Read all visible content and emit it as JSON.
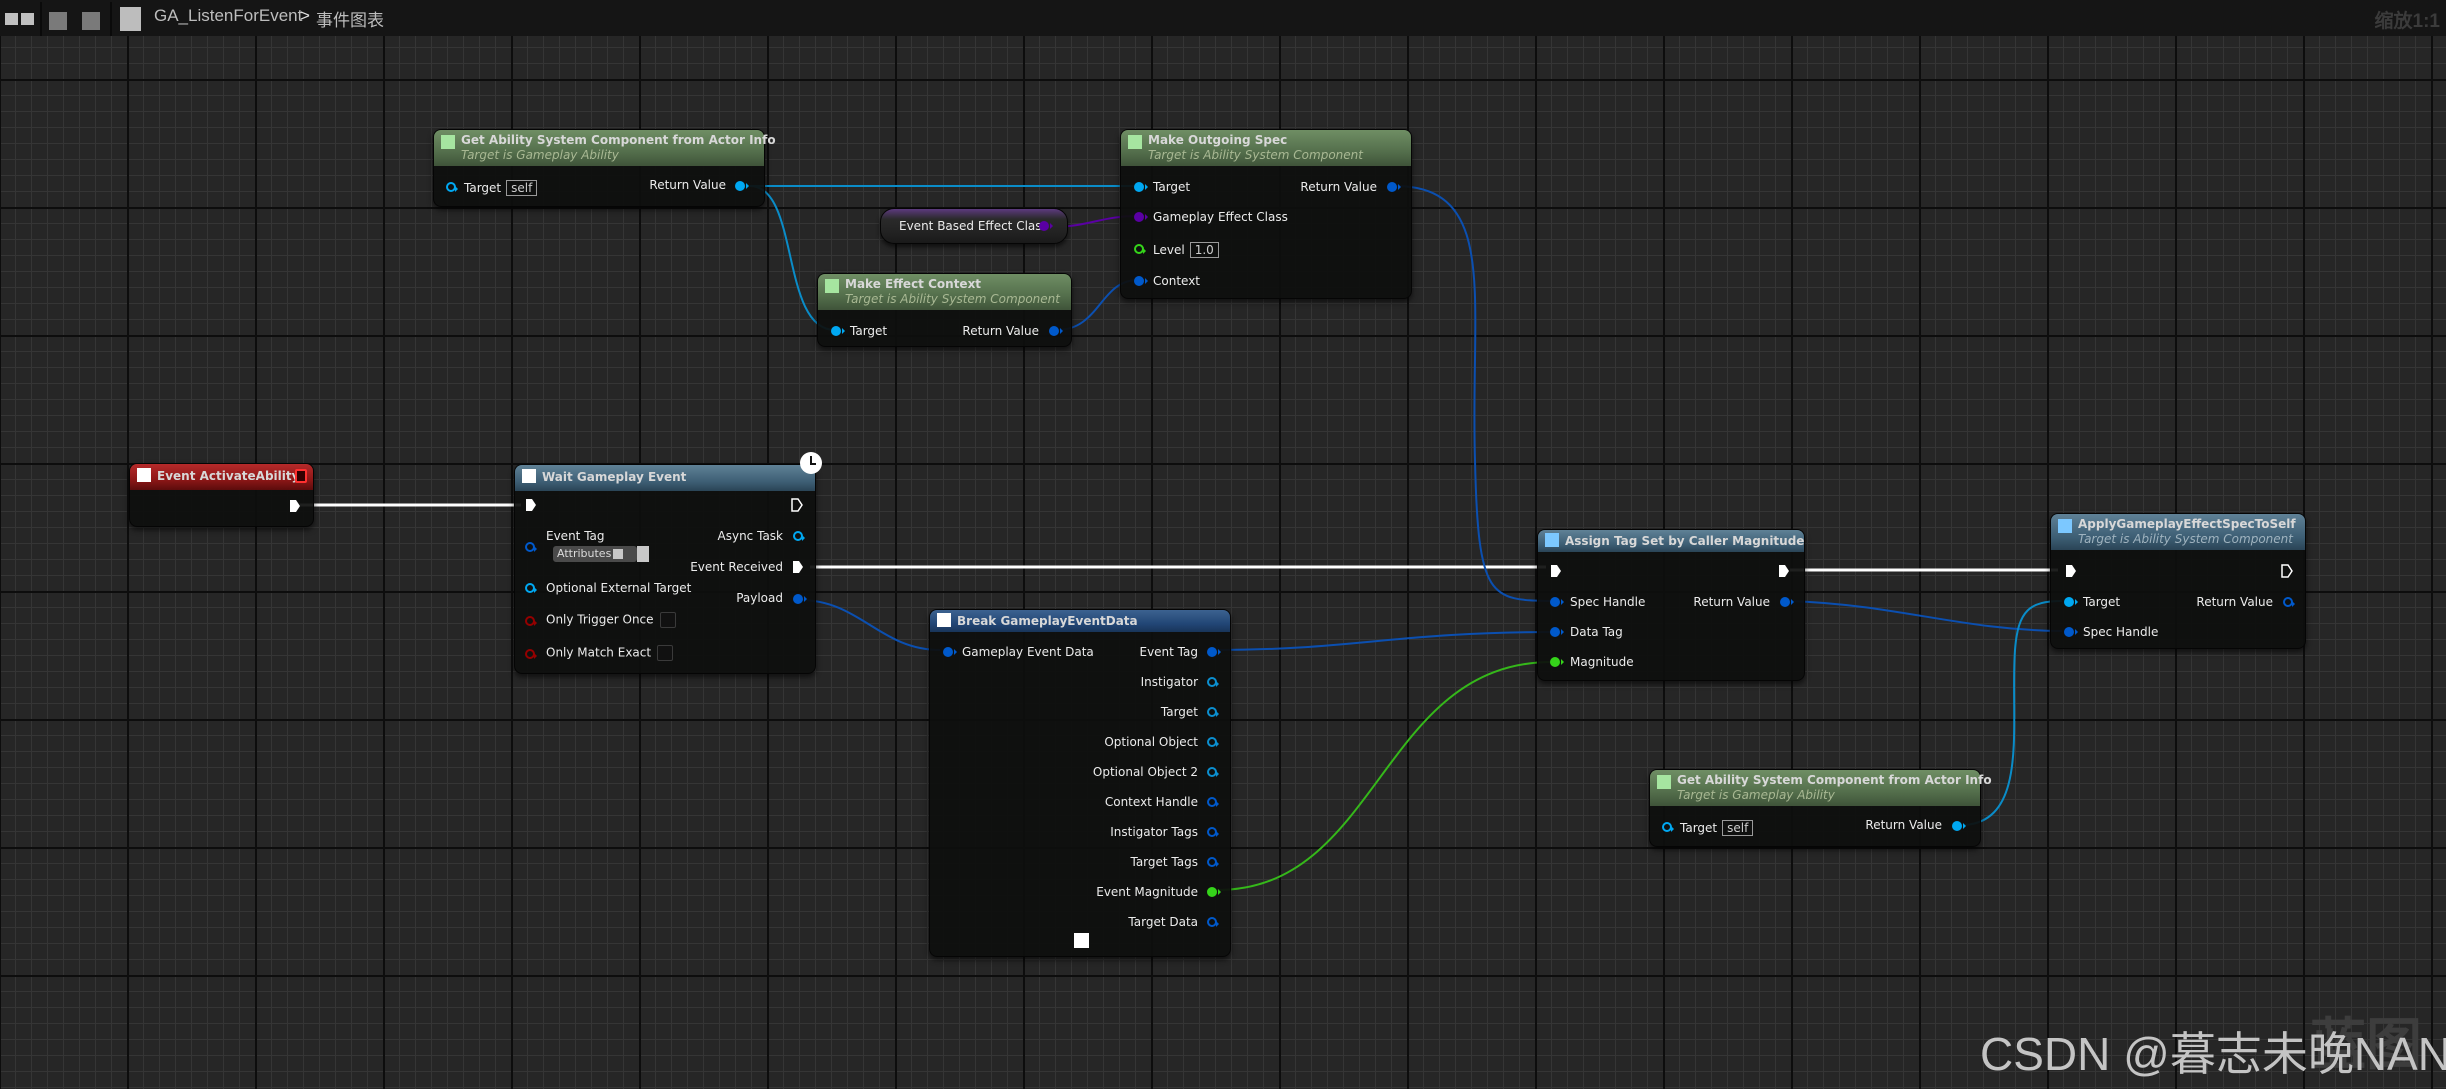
{
  "toolbar": {
    "icons": [
      "panel-layout-icon",
      "back-icon",
      "forward-icon",
      "blueprint-icon"
    ],
    "breadcrumb": {
      "asset": "GA_ListenForEvent",
      "separator": ">",
      "graph": "事件图表"
    },
    "zoom_label": "缩放1:1"
  },
  "colors": {
    "exec_wire": "#ffffff",
    "object_pin": "#00a8f2",
    "struct_pin": "#0059cb",
    "class_pin": "#5a00a3",
    "float_pin": "#35d41a",
    "bool_pin": "#950000",
    "pure_header": "#546f4c",
    "function_header": "#3d5e74",
    "struct_header": "#214574",
    "event_header": "#8d1717"
  },
  "nodes": {
    "get_asc_top": {
      "title": "Get Ability System Component from Actor Info",
      "subtitle": "Target is Gameplay Ability",
      "inputs": [
        {
          "label": "Target",
          "value": "self"
        }
      ],
      "outputs": [
        {
          "label": "Return Value"
        }
      ]
    },
    "event_based_effect_class": {
      "label": "Event Based Effect Class"
    },
    "make_effect_context": {
      "title": "Make Effect Context",
      "subtitle": "Target is Ability System Component",
      "inputs": [
        {
          "label": "Target"
        }
      ],
      "outputs": [
        {
          "label": "Return Value"
        }
      ]
    },
    "make_outgoing_spec": {
      "title": "Make Outgoing Spec",
      "subtitle": "Target is Ability System Component",
      "inputs": [
        {
          "label": "Target"
        },
        {
          "label": "Gameplay Effect Class"
        },
        {
          "label": "Level",
          "value": "1.0"
        },
        {
          "label": "Context"
        }
      ],
      "outputs": [
        {
          "label": "Return Value"
        }
      ]
    },
    "event_activate_ability": {
      "title": "Event ActivateAbility"
    },
    "wait_gameplay_event": {
      "title": "Wait Gameplay Event",
      "inputs": [
        {
          "label": "Event Tag",
          "value": "Attributes"
        },
        {
          "label": "Optional External Target"
        },
        {
          "label": "Only Trigger Once",
          "checked": false
        },
        {
          "label": "Only Match Exact",
          "checked": false
        }
      ],
      "outputs": [
        {
          "label": "Async Task"
        },
        {
          "label": "Event Received"
        },
        {
          "label": "Payload"
        }
      ]
    },
    "break_gameplay_event_data": {
      "title": "Break GameplayEventData",
      "inputs": [
        {
          "label": "Gameplay Event Data"
        }
      ],
      "outputs": [
        {
          "label": "Event Tag"
        },
        {
          "label": "Instigator"
        },
        {
          "label": "Target"
        },
        {
          "label": "Optional Object"
        },
        {
          "label": "Optional Object 2"
        },
        {
          "label": "Context Handle"
        },
        {
          "label": "Instigator Tags"
        },
        {
          "label": "Target Tags"
        },
        {
          "label": "Event Magnitude"
        },
        {
          "label": "Target Data"
        }
      ]
    },
    "assign_tag_set_by_caller": {
      "title": "Assign Tag Set by Caller Magnitude",
      "inputs": [
        {
          "label": "Spec Handle"
        },
        {
          "label": "Data Tag"
        },
        {
          "label": "Magnitude"
        }
      ],
      "outputs": [
        {
          "label": "Return Value"
        }
      ]
    },
    "apply_ge_spec_to_self": {
      "title": "ApplyGameplayEffectSpecToSelf",
      "subtitle": "Target is Ability System Component",
      "inputs": [
        {
          "label": "Target"
        },
        {
          "label": "Spec Handle"
        }
      ],
      "outputs": [
        {
          "label": "Return Value"
        }
      ]
    },
    "get_asc_bottom": {
      "title": "Get Ability System Component from Actor Info",
      "subtitle": "Target is Gameplay Ability",
      "inputs": [
        {
          "label": "Target",
          "value": "self"
        }
      ],
      "outputs": [
        {
          "label": "Return Value"
        }
      ]
    }
  },
  "watermarks": {
    "graph_type": "蓝图",
    "credit": "CSDN @暮志未晚NAN"
  }
}
